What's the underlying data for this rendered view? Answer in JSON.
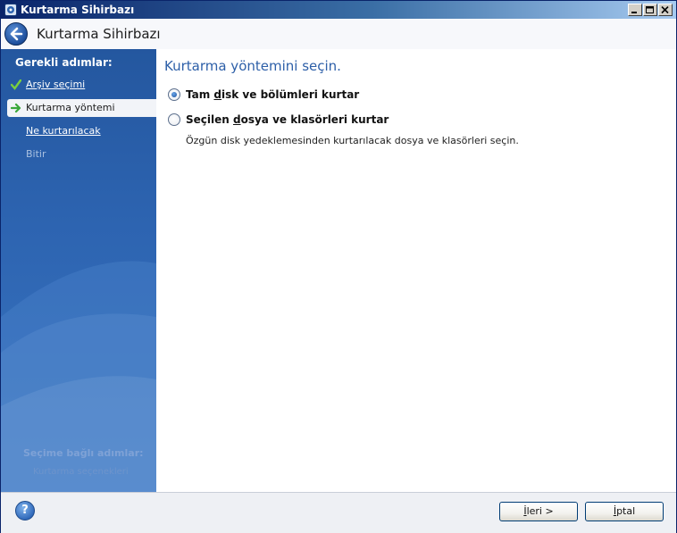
{
  "window": {
    "title": "Kurtarma Sihirbazı",
    "controls": [
      "minimize-icon",
      "maximize-icon",
      "close-icon"
    ]
  },
  "header": {
    "back_icon": "back-arrow-icon",
    "title": "Kurtarma Sihirbazı"
  },
  "sidebar": {
    "required_heading": "Gerekli adımlar:",
    "steps": [
      {
        "label": "Arşiv seçimi",
        "state": "done",
        "icon": "checkmark-icon"
      },
      {
        "label": "Kurtarma yöntemi",
        "state": "current",
        "icon": "arrow-right-icon"
      },
      {
        "label": "Ne kurtarılacak",
        "state": "link"
      },
      {
        "label": "Bitir",
        "state": "disabled"
      }
    ],
    "optional_heading": "Seçime bağlı adımlar:",
    "optional_item": "Kurtarma seçenekleri"
  },
  "main": {
    "title": "Kurtarma yöntemini seçin.",
    "options": [
      {
        "pre": "Tam ",
        "key": "d",
        "post": "isk ve bölümleri kurtar",
        "selected": true
      },
      {
        "pre": "Seçilen ",
        "key": "d",
        "post": "osya ve klasörleri kurtar",
        "selected": false
      }
    ],
    "description": "Özgün disk yedeklemesinden kurtarılacak dosya ve klasörleri seçin."
  },
  "footer": {
    "help_icon": "help-icon",
    "help_glyph": "?",
    "next": {
      "key": "İ",
      "rest": "leri >"
    },
    "cancel": {
      "key": "İ",
      "rest": "ptal"
    }
  },
  "colors": {
    "titlebar_start": "#0a246a",
    "sidebar": "#2d64b1",
    "accent_title": "#2d5fa8"
  }
}
